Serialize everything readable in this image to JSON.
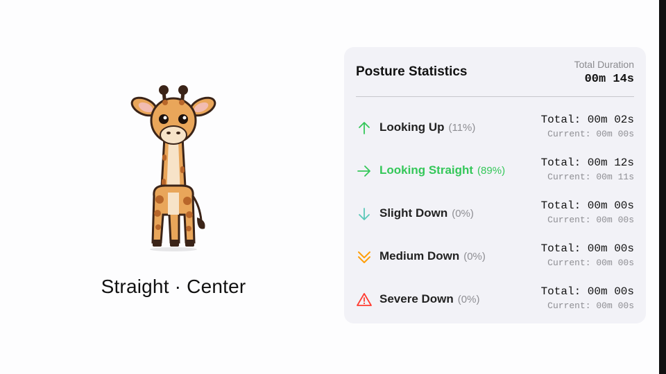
{
  "posture_label": "Straight · Center",
  "stats": {
    "title": "Posture Statistics",
    "total_duration_label": "Total Duration",
    "total_duration_value": "00m 14s",
    "rows": [
      {
        "icon": "arrow-up-icon",
        "label": "Looking Up",
        "percent": "(11%)",
        "total": "Total: 00m 02s",
        "current": "Current: 00m 00s",
        "color": "#34c759",
        "active": false
      },
      {
        "icon": "arrow-right-icon",
        "label": "Looking Straight",
        "percent": "(89%)",
        "total": "Total: 00m 12s",
        "current": "Current: 00m 11s",
        "color": "#34c759",
        "active": true
      },
      {
        "icon": "arrow-down-icon",
        "label": "Slight Down",
        "percent": "(0%)",
        "total": "Total: 00m 00s",
        "current": "Current: 00m 00s",
        "color": "#5ac8b8",
        "active": false
      },
      {
        "icon": "double-chevron-down-icon",
        "label": "Medium Down",
        "percent": "(0%)",
        "total": "Total: 00m 00s",
        "current": "Current: 00m 00s",
        "color": "#ff9f0a",
        "active": false
      },
      {
        "icon": "warning-triangle-icon",
        "label": "Severe Down",
        "percent": "(0%)",
        "total": "Total: 00m 00s",
        "current": "Current: 00m 00s",
        "color": "#ff3b30",
        "active": false
      }
    ]
  },
  "colors": {
    "accent_green": "#34c759",
    "card_bg": "#f2f2f7",
    "giraffe_body": "#e9a65a",
    "giraffe_spots": "#b8662a"
  }
}
